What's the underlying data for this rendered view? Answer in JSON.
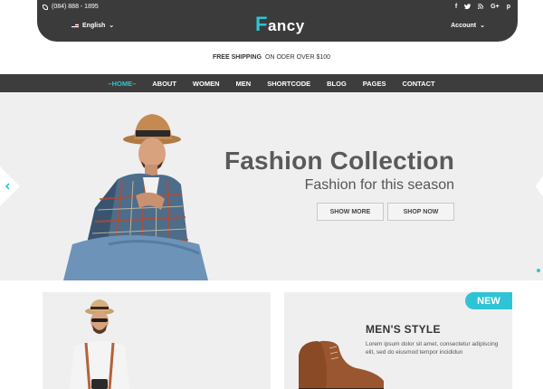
{
  "topbar": {
    "phone": "(084) 888 - 1895",
    "language": "English",
    "logo_first": "F",
    "logo_rest": "ancy",
    "socials": [
      "f",
      "t",
      "rss",
      "G+",
      "p"
    ],
    "account": "Account"
  },
  "shipping": {
    "bold": "FREE SHIPPING",
    "text": "ON ODER OVER $100"
  },
  "nav": [
    "HOME",
    "ABOUT",
    "WOMEN",
    "MEN",
    "SHORTCODE",
    "BLOG",
    "PAGES",
    "CONTACT"
  ],
  "hero": {
    "title": "Fashion Collection",
    "subtitle": "Fashion for this season",
    "btn_show_more": "SHOW MORE",
    "btn_shop_now": "SHOP NOW"
  },
  "cards": {
    "badge": "NEW",
    "mens_title": "MEN'S STYLE",
    "mens_text": "Lorem ipsum dolor sit amet, consectetur adipiscing elit, sed do eiusmod tempor incididun"
  },
  "colors": {
    "accent": "#2ec4d6",
    "dark": "#3b3b3b",
    "hero_bg": "#efefef"
  }
}
